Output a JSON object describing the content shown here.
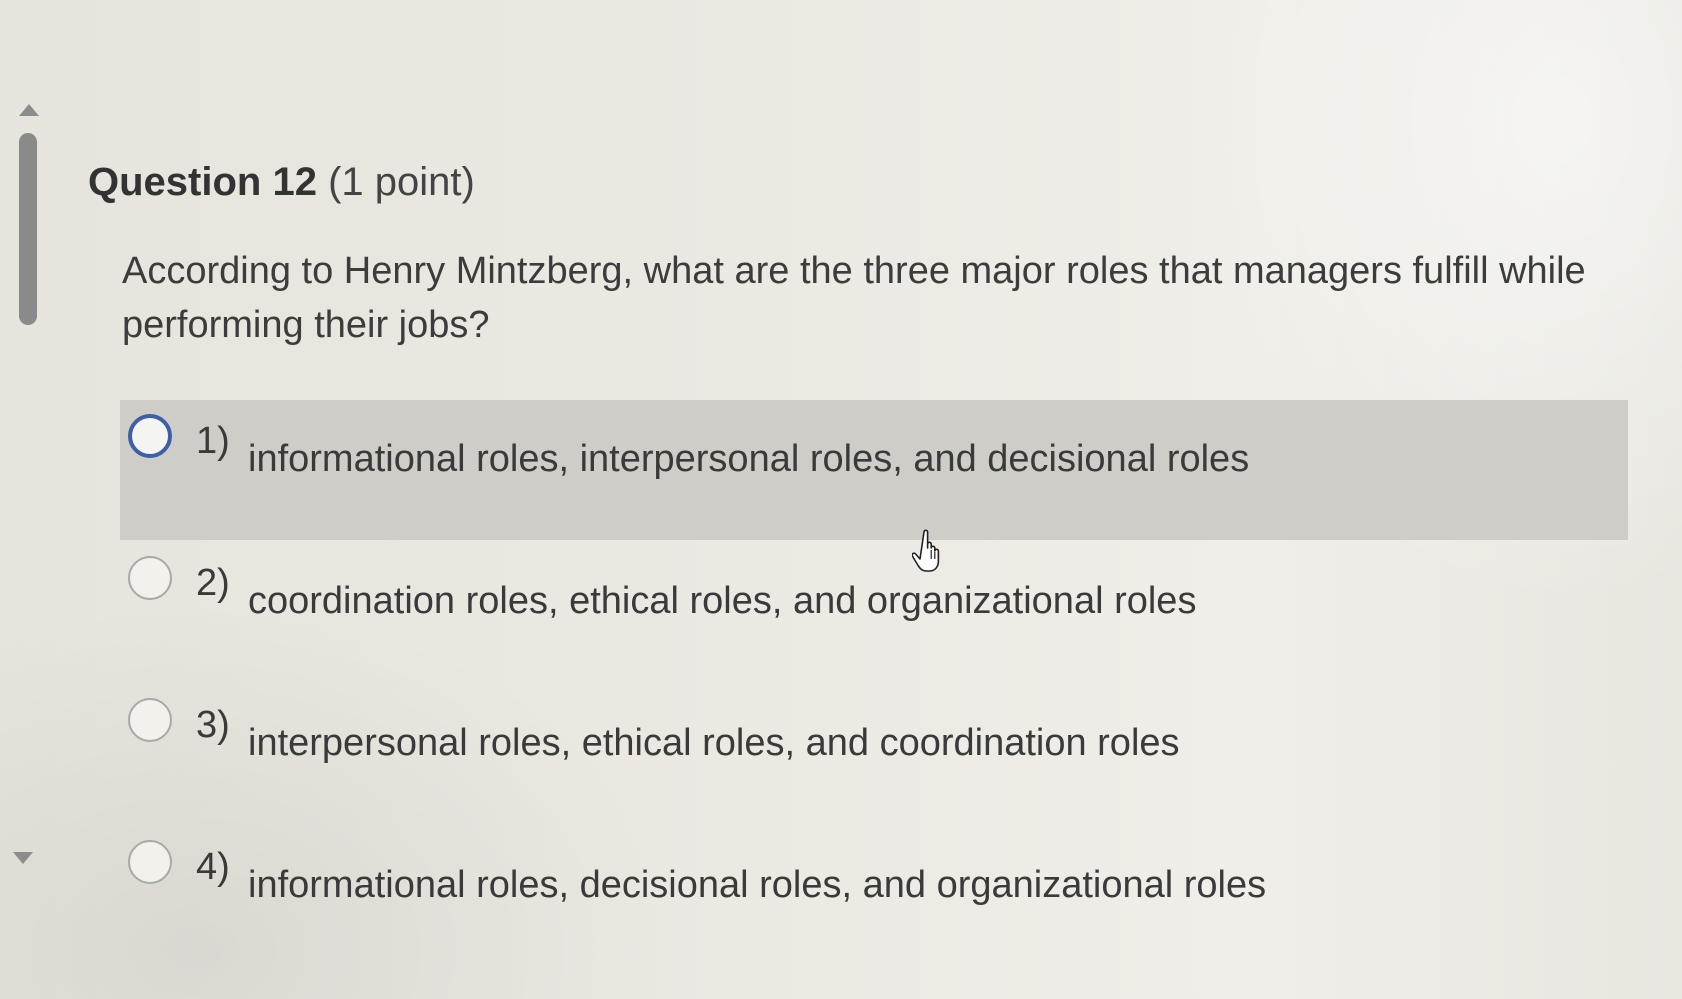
{
  "question": {
    "number_label": "Question 12",
    "points_label": "(1 point)",
    "text": "According to Henry Mintzberg, what are the three major roles that managers fulfill while performing their jobs?"
  },
  "options": [
    {
      "number": "1)",
      "label": "informational roles, interpersonal roles, and decisional roles",
      "highlighted": true
    },
    {
      "number": "2)",
      "label": "coordination roles, ethical roles, and organizational roles",
      "highlighted": false
    },
    {
      "number": "3)",
      "label": "interpersonal roles, ethical roles, and coordination roles",
      "highlighted": false
    },
    {
      "number": "4)",
      "label": "informational roles, decisional roles, and organizational roles",
      "highlighted": false
    }
  ],
  "icons": {
    "cursor": "hand-pointer-icon",
    "scroll_up": "triangle-up-icon",
    "scroll_down": "triangle-down-icon"
  },
  "colors": {
    "highlight_row": "#cfcdc7",
    "focused_radio": "#3d5fa8",
    "scrollbar": "#8a8a8a"
  }
}
